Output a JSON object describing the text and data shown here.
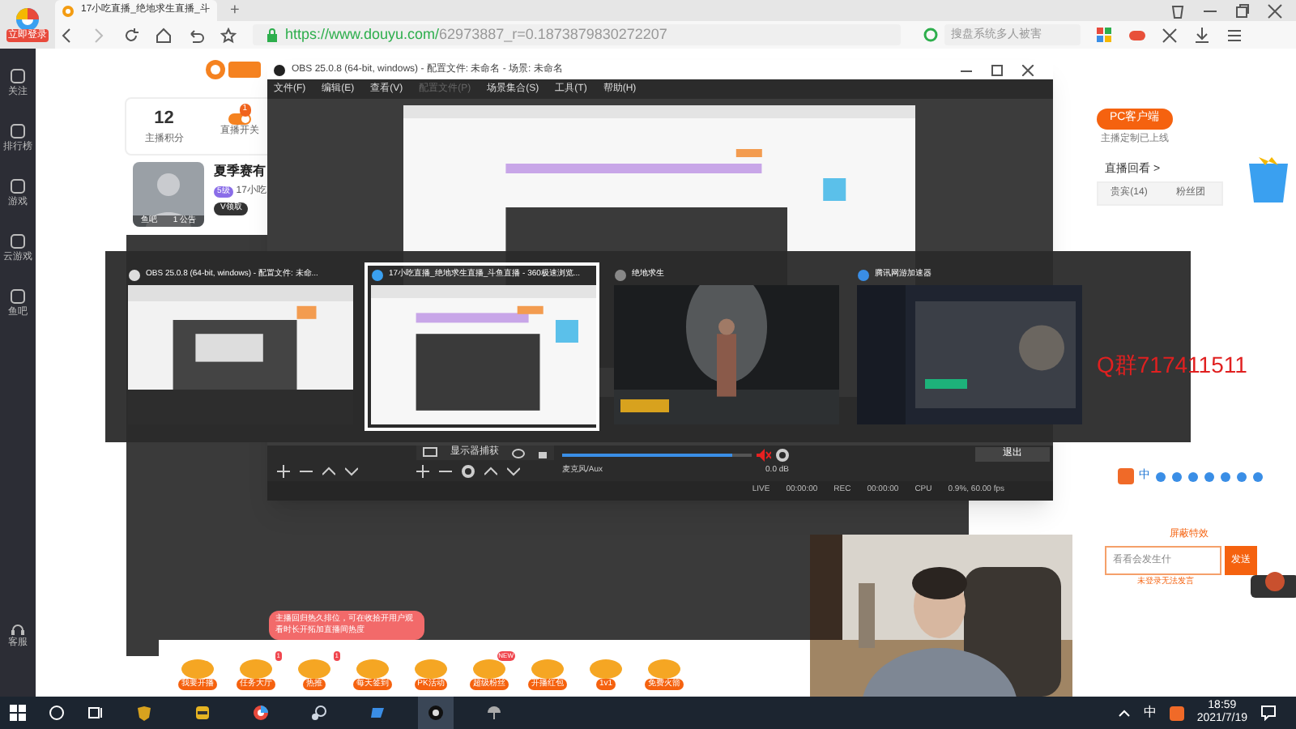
{
  "browser": {
    "tab_title": "17小吃直播_绝地求生直播_斗",
    "url_host": "https://www.douyu.com/",
    "url_path": "62973887_r=0.1873879830272207",
    "search": {
      "placeholder": "搜盘系统多人被害"
    },
    "login_badge": "立即登录",
    "new_tab": "+"
  },
  "sidebar": {
    "items": [
      {
        "label": "关注"
      },
      {
        "label": "排行榜"
      },
      {
        "label": "游戏"
      },
      {
        "label": "云游戏"
      },
      {
        "label": "鱼吧"
      }
    ],
    "bottom": "客服"
  },
  "stats": {
    "score": "12",
    "score_label": "主播积分",
    "switch_label": "直播开关",
    "switch_badge": "1",
    "pc_client": "PC客户端",
    "pc_note": "主播定制已上线",
    "replay": "直播回看 >"
  },
  "room": {
    "title": "夏季赛有",
    "host": "17小吃",
    "level": "5级",
    "claim": "V领取",
    "fish": "鱼吧",
    "notice": "1 公告"
  },
  "chat_tabs": [
    {
      "label": "贵宾(14)",
      "selected": false
    },
    {
      "label": "粉丝团",
      "selected": false
    }
  ],
  "obs": {
    "title": "OBS 25.0.8 (64-bit, windows) - 配置文件: 未命名 - 场景: 未命名",
    "menu": [
      {
        "label": "文件(F)",
        "disabled": false
      },
      {
        "label": "编辑(E)",
        "disabled": false
      },
      {
        "label": "查看(V)",
        "disabled": false
      },
      {
        "label": "配置文件(P)",
        "disabled": true
      },
      {
        "label": "场景集合(S)",
        "disabled": false
      },
      {
        "label": "工具(T)",
        "disabled": false
      },
      {
        "label": "帮助(H)",
        "disabled": false
      }
    ],
    "source": "显示器捕获",
    "mixer_name": "麦克风/Aux",
    "mixer_db": "0.0 dB",
    "volume": {
      "level": 0.9
    },
    "muted": true,
    "exit": "退出",
    "status": [
      {
        "label": "LIVE",
        "value": "00:00:00"
      },
      {
        "label": "REC",
        "value": "00:00:00"
      },
      {
        "label": "CPU",
        "value": "0.9%, 60.00 fps"
      }
    ]
  },
  "task_switcher": [
    {
      "title": "OBS 25.0.8 (64-bit, windows) - 配置文件: 未命...",
      "selected": false
    },
    {
      "title": "17小吃直播_绝地求生直播_斗鱼直播 - 360极速浏览...",
      "selected": true
    },
    {
      "title": "绝地求生",
      "selected": false
    },
    {
      "title": "腾讯网游加速器",
      "selected": false
    }
  ],
  "overlay_text": "Q群717411511",
  "tooltip": "主播回归热久排位，可在收拾开用户观看时长开拓加直播间热度",
  "gifts": [
    {
      "label": "我要开播"
    },
    {
      "label": "任务大厅",
      "badge": "1"
    },
    {
      "label": "热推",
      "badge": "1"
    },
    {
      "label": "每天签到"
    },
    {
      "label": "PK活动"
    },
    {
      "label": "超级粉丝",
      "badge": "NEW"
    },
    {
      "label": "开播红包"
    },
    {
      "label": "1v1"
    },
    {
      "label": "免费火箭"
    }
  ],
  "chat": {
    "block_effects": "屏蔽特效",
    "placeholder": "看看会发生什",
    "send": "发送",
    "note": "未登录无法发言"
  },
  "ime": "中",
  "taskbar": {
    "ime": "中",
    "time": "18:59",
    "date": "2021/7/19"
  }
}
